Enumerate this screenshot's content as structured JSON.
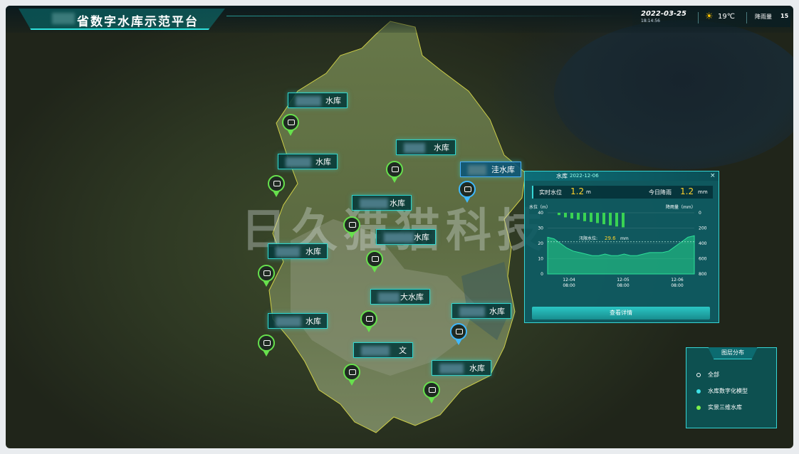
{
  "header": {
    "title": "省数字水库示范平台",
    "date": "2022-03-25",
    "time": "18:14:56",
    "weather_icon": "sun-icon",
    "temperature": "19℃",
    "rain_label": "降雨量",
    "rain_value": "15"
  },
  "map_labels": [
    {
      "text": "水库"
    },
    {
      "text": "水库"
    },
    {
      "text": "水库"
    },
    {
      "text": "水库"
    },
    {
      "text": "洼水库"
    },
    {
      "text": "水库"
    },
    {
      "text": "水库"
    },
    {
      "text": "大水库"
    },
    {
      "text": "水库"
    },
    {
      "text": "水库"
    },
    {
      "text": "水库"
    },
    {
      "text": "文"
    }
  ],
  "popup": {
    "name": "水库",
    "date": "2022-12-06",
    "close": "×",
    "realtime_label": "实时水位",
    "realtime_value": "1.2",
    "realtime_unit": "m",
    "rain_label": "今日降雨",
    "rain_value": "1.2",
    "rain_unit": "mm",
    "button": "查看详情",
    "chart_data": {
      "type": "area",
      "ylabel_left": "水位（m）",
      "ylabel_right": "降雨量（mm）",
      "y_left_ticks": [
        "40",
        "30",
        "20",
        "10",
        "0"
      ],
      "y_right_ticks": [
        "0",
        "200",
        "400",
        "600",
        "800"
      ],
      "x_ticks": [
        {
          "date": "12-04",
          "time": "08:00"
        },
        {
          "date": "12-05",
          "time": "08:00"
        },
        {
          "date": "12-06",
          "time": "08:00"
        }
      ],
      "flood_label": "汛限水位:",
      "flood_value": "29.6",
      "flood_unit": "mm",
      "water_level": [
        24,
        23,
        20,
        17,
        15,
        14,
        13,
        12,
        12,
        13,
        12,
        12,
        13,
        12,
        12,
        13,
        14,
        14,
        14,
        15,
        18,
        21,
        24,
        25
      ],
      "rainfall": [
        30,
        60,
        75,
        90,
        110,
        120,
        135,
        150,
        165,
        180,
        190
      ]
    }
  },
  "legend": {
    "title": "图层分布",
    "items": [
      {
        "label": "全部",
        "color": "#ffffff"
      },
      {
        "label": "水库数字化模型",
        "color": "#3ee1e6"
      },
      {
        "label": "实景三维水库",
        "color": "#7cf14a"
      }
    ]
  },
  "watermark": "日久猫猫科技"
}
